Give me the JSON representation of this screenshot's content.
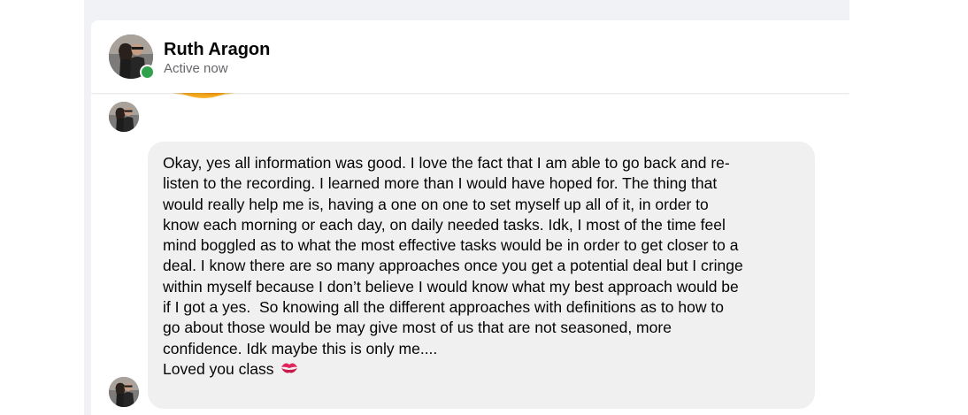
{
  "chat": {
    "contact_name": "Ruth Aragon",
    "status": "Active now"
  },
  "messages": {
    "emoji": {
      "icon": "face-with-hand-over-mouth-emoji",
      "color": "#f7b129"
    },
    "text_body": "Okay, yes all information was good. I love the fact that I am able to go back and re-\nlisten to the recording. I learned more than I would have hoped for. The thing that\nwould really help me is, having a one on one to set myself up all of it, in order to\nknow each morning or each day, on daily needed tasks. Idk, I most of the time feel\nmind boggled as to what the most effective tasks would be in order to get closer to a\ndeal. I know there are so many approaches once you get a potential deal but I cringe\nwithin myself because I don’t believe I would know what my best approach would be\nif I got a yes.  So knowing all the different approaches with definitions as to how to\ngo about those would be may give most of us that are not seasoned, more\nconfidence. Idk maybe this is only me....",
    "last_line": "Loved you class",
    "last_line_icon": "kiss-mark-emoji"
  },
  "colors": {
    "presence": "#31a24c",
    "bubble": "#f0f0f0",
    "kiss": "#e0245e"
  }
}
